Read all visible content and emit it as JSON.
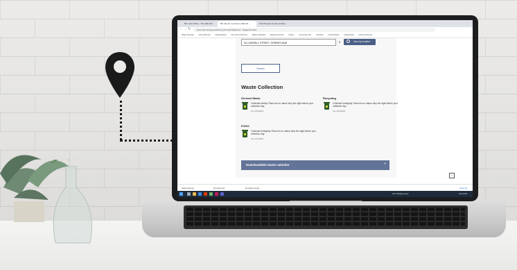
{
  "browser": {
    "tabs": [
      {
        "label": "Bin Lists Online - The Hills Shi..."
      },
      {
        "label": "Bin day for my street | Hills Sh..."
      },
      {
        "label": "Find Recycle Centre & Days..."
      }
    ],
    "address": "mycouncil.nsw.gov.au/find-my-bin-day?address=...&page=bin-day",
    "bookmarks": [
      "Waste Services",
      "Online Bin Info",
      "Administration",
      "My Council Services",
      "Waste Collection",
      "Reports & Forms",
      "Library",
      "Community Info",
      "Lost Pets",
      "Council Alerts",
      "Local Events",
      "Forms & Permits"
    ]
  },
  "page": {
    "address_value": "54 CARMELL STREET, SHRIMPLAND",
    "use_location_label": "Use my location",
    "search_label": "Search",
    "heading": "Waste Collection",
    "sections": {
      "general": {
        "title": "General Waste",
        "text": "Collected weekly. Place bin on nature strip the night before your collection day.",
        "date": "Tue 10/1/2023"
      },
      "recycling": {
        "title": "Recycling",
        "text": "Collected fortnightly. Place bin on nature strip the night before your collection day.",
        "date": "Tue 10/1/2023"
      },
      "fogo": {
        "title": "FOGO",
        "text": "Collected fortnightly. Place bin on nature strip the night before your collection day.",
        "date": "Tue 10/1/2023"
      }
    },
    "download_label": "Downloadable waste calendar",
    "download_icon": "plus-icon",
    "scroll_top_icon": "chevron-up-icon"
  },
  "downloads": {
    "items": [
      "waste-cal.png",
      "bin-days.png",
      "bin-days (1).png"
    ],
    "show_all": "Show all"
  },
  "taskbar": {
    "weather": "21°C  Mostly sunny",
    "clock": "10:21 AM"
  },
  "colors": {
    "accent": "#4a5f86",
    "download_bar": "#637499",
    "bin_green": "#2f5d2a",
    "bin_label": "#cfd32c"
  }
}
